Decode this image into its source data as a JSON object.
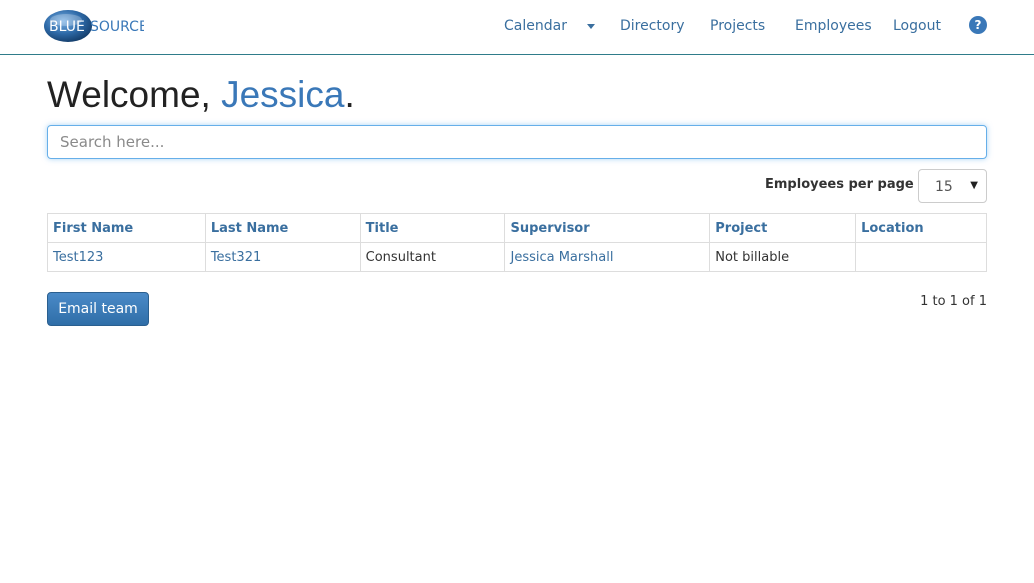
{
  "brand": {
    "logo_text_left": "BLUE",
    "logo_text_right": "SOURCE",
    "colors": {
      "primary": "#3a78b8",
      "nav_border": "#2f7c8a",
      "link": "#3a6f9f"
    }
  },
  "nav": {
    "calendar": "Calendar",
    "directory": "Directory",
    "projects": "Projects",
    "employees": "Employees",
    "logout": "Logout",
    "help_icon": "question-circle-icon",
    "help_glyph": "?"
  },
  "welcome": {
    "prefix": "Welcome, ",
    "name": "Jessica",
    "suffix": "."
  },
  "search": {
    "placeholder": "Search here...",
    "value": ""
  },
  "per_page": {
    "label": "Employees per page",
    "value": "15",
    "arrow": "▼"
  },
  "table": {
    "headers": [
      "First Name",
      "Last Name",
      "Title",
      "Supervisor",
      "Project",
      "Location"
    ],
    "rows": [
      [
        "Test123",
        "Test321",
        "Consultant",
        "Jessica Marshall",
        "Not billable",
        ""
      ]
    ]
  },
  "actions": {
    "email_team": "Email team"
  },
  "pagination": {
    "info": "1 to 1 of 1"
  }
}
